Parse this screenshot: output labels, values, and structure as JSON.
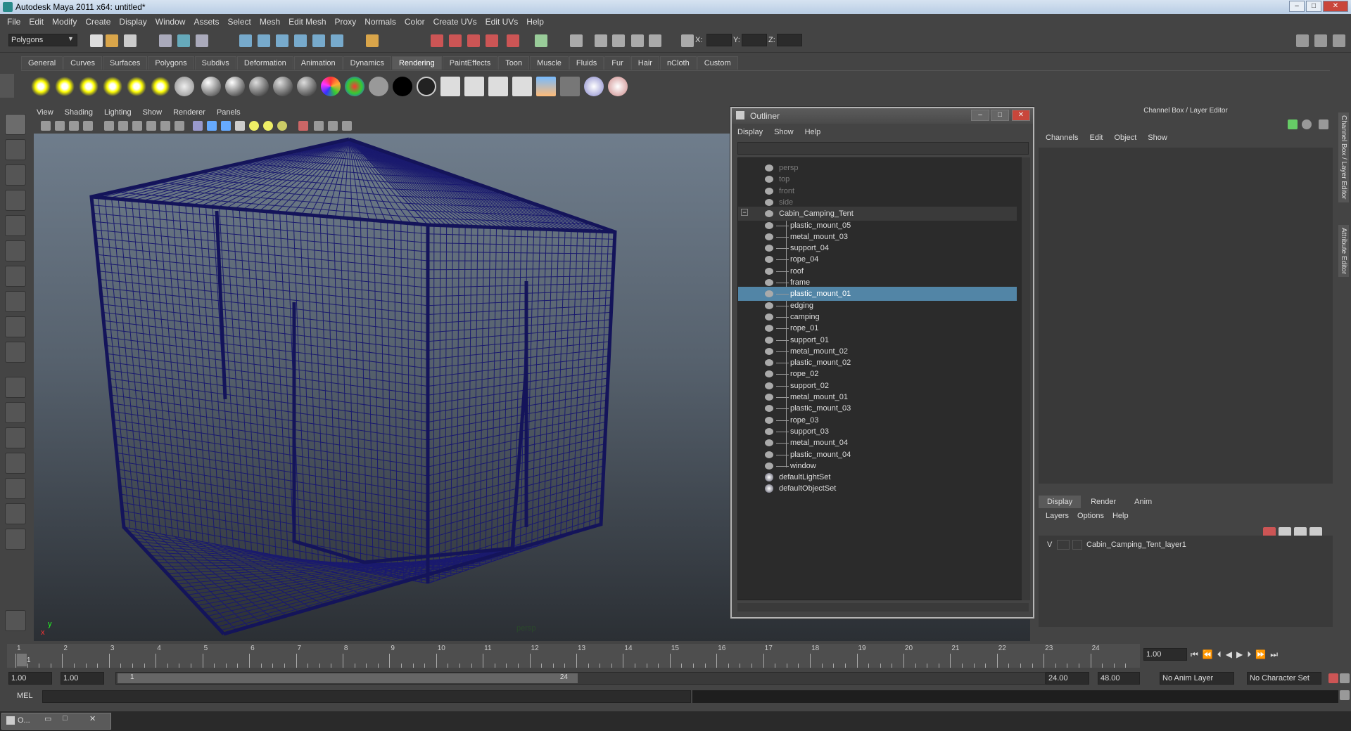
{
  "window": {
    "title": "Autodesk Maya 2011 x64: untitled*",
    "btn_min": "–",
    "btn_max": "□",
    "btn_close": "✕"
  },
  "menubar": [
    "File",
    "Edit",
    "Modify",
    "Create",
    "Display",
    "Window",
    "Assets",
    "Select",
    "Mesh",
    "Edit Mesh",
    "Proxy",
    "Normals",
    "Color",
    "Create UVs",
    "Edit UVs",
    "Help"
  ],
  "statusline": {
    "mode": "Polygons",
    "x_label": "X:",
    "y_label": "Y:",
    "z_label": "Z:"
  },
  "shelf_tabs": [
    "General",
    "Curves",
    "Surfaces",
    "Polygons",
    "Subdivs",
    "Deformation",
    "Animation",
    "Dynamics",
    "Rendering",
    "PaintEffects",
    "Toon",
    "Muscle",
    "Fluids",
    "Fur",
    "Hair",
    "nCloth",
    "Custom"
  ],
  "shelf_active": "Rendering",
  "viewport": {
    "menu": [
      "View",
      "Shading",
      "Lighting",
      "Show",
      "Renderer",
      "Panels"
    ],
    "camera_label": "persp",
    "axis_x": "x",
    "axis_y": "y"
  },
  "outliner": {
    "title": "Outliner",
    "menu": [
      "Display",
      "Show",
      "Help"
    ],
    "items": [
      {
        "label": "persp",
        "kind": "camera"
      },
      {
        "label": "top",
        "kind": "camera"
      },
      {
        "label": "front",
        "kind": "camera"
      },
      {
        "label": "side",
        "kind": "camera"
      },
      {
        "label": "Cabin_Camping_Tent",
        "kind": "group"
      },
      {
        "label": "plastic_mount_05",
        "kind": "child"
      },
      {
        "label": "metal_mount_03",
        "kind": "child"
      },
      {
        "label": "support_04",
        "kind": "child"
      },
      {
        "label": "rope_04",
        "kind": "child"
      },
      {
        "label": "roof",
        "kind": "child"
      },
      {
        "label": "frame",
        "kind": "child"
      },
      {
        "label": "plastic_mount_01",
        "kind": "selected"
      },
      {
        "label": "edging",
        "kind": "child"
      },
      {
        "label": "camping",
        "kind": "child"
      },
      {
        "label": "rope_01",
        "kind": "child"
      },
      {
        "label": "support_01",
        "kind": "child"
      },
      {
        "label": "metal_mount_02",
        "kind": "child"
      },
      {
        "label": "plastic_mount_02",
        "kind": "child"
      },
      {
        "label": "rope_02",
        "kind": "child"
      },
      {
        "label": "support_02",
        "kind": "child"
      },
      {
        "label": "metal_mount_01",
        "kind": "child"
      },
      {
        "label": "plastic_mount_03",
        "kind": "child"
      },
      {
        "label": "rope_03",
        "kind": "child"
      },
      {
        "label": "support_03",
        "kind": "child"
      },
      {
        "label": "metal_mount_04",
        "kind": "child"
      },
      {
        "label": "plastic_mount_04",
        "kind": "child"
      },
      {
        "label": "window",
        "kind": "child"
      },
      {
        "label": "defaultLightSet",
        "kind": "set"
      },
      {
        "label": "defaultObjectSet",
        "kind": "set"
      }
    ]
  },
  "channelbox": {
    "title": "Channel Box / Layer Editor",
    "menu": [
      "Channels",
      "Edit",
      "Object",
      "Show"
    ],
    "layer_tabs": [
      "Display",
      "Render",
      "Anim"
    ],
    "layer_menu": [
      "Layers",
      "Options",
      "Help"
    ],
    "layer": {
      "visible": "V",
      "name": "Cabin_Camping_Tent_layer1"
    }
  },
  "sidetabs": [
    "Channel Box / Layer Editor",
    "Attribute Editor"
  ],
  "timeslider": {
    "ticks": [
      "1",
      "2",
      "3",
      "4",
      "5",
      "6",
      "7",
      "8",
      "9",
      "10",
      "11",
      "12",
      "13",
      "14",
      "15",
      "16",
      "17",
      "18",
      "19",
      "20",
      "21",
      "22",
      "23",
      "24"
    ],
    "current": "1",
    "current_frame_field": "1.00"
  },
  "range": {
    "start": "1.00",
    "playback_start": "1.00",
    "range_start_label": "1",
    "range_end_label": "24",
    "playback_end": "24.00",
    "end": "48.00",
    "anim_layer": "No Anim Layer",
    "char_set": "No Character Set"
  },
  "cmdline": {
    "label": "MEL"
  },
  "taskbar": {
    "label": "O..."
  },
  "colors": {
    "wire": "#1a1a6e",
    "selection": "#5285a6",
    "bg": "#444444"
  }
}
